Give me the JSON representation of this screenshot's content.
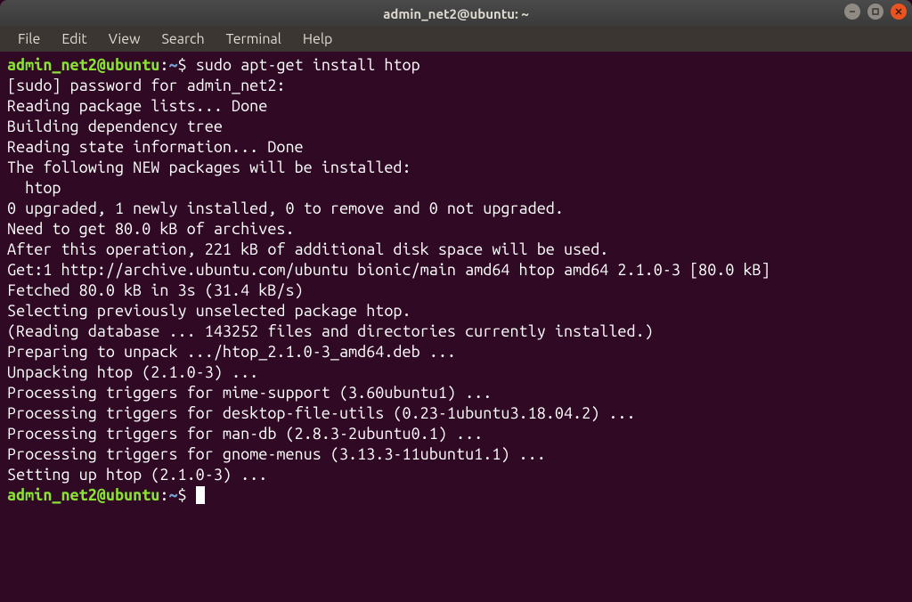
{
  "window": {
    "title": "admin_net2@ubuntu: ~"
  },
  "menubar": {
    "items": [
      "File",
      "Edit",
      "View",
      "Search",
      "Terminal",
      "Help"
    ]
  },
  "prompt1": {
    "userhost": "admin_net2@ubuntu",
    "colon": ":",
    "path": "~",
    "sign": "$ ",
    "command": "sudo apt-get install htop"
  },
  "output": {
    "l0": "[sudo] password for admin_net2:",
    "l1": "Reading package lists... Done",
    "l2": "Building dependency tree",
    "l3": "Reading state information... Done",
    "l4": "The following NEW packages will be installed:",
    "l5": "  htop",
    "l6": "0 upgraded, 1 newly installed, 0 to remove and 0 not upgraded.",
    "l7": "Need to get 80.0 kB of archives.",
    "l8": "After this operation, 221 kB of additional disk space will be used.",
    "l9": "Get:1 http://archive.ubuntu.com/ubuntu bionic/main amd64 htop amd64 2.1.0-3 [80.0 kB]",
    "l10": "Fetched 80.0 kB in 3s (31.4 kB/s)",
    "l11": "Selecting previously unselected package htop.",
    "l12": "(Reading database ... 143252 files and directories currently installed.)",
    "l13": "Preparing to unpack .../htop_2.1.0-3_amd64.deb ...",
    "l14": "Unpacking htop (2.1.0-3) ...",
    "l15": "Processing triggers for mime-support (3.60ubuntu1) ...",
    "l16": "Processing triggers for desktop-file-utils (0.23-1ubuntu3.18.04.2) ...",
    "l17": "Processing triggers for man-db (2.8.3-2ubuntu0.1) ...",
    "l18": "Processing triggers for gnome-menus (3.13.3-11ubuntu1.1) ...",
    "l19": "Setting up htop (2.1.0-3) ..."
  },
  "prompt2": {
    "userhost": "admin_net2@ubuntu",
    "colon": ":",
    "path": "~",
    "sign": "$ "
  }
}
